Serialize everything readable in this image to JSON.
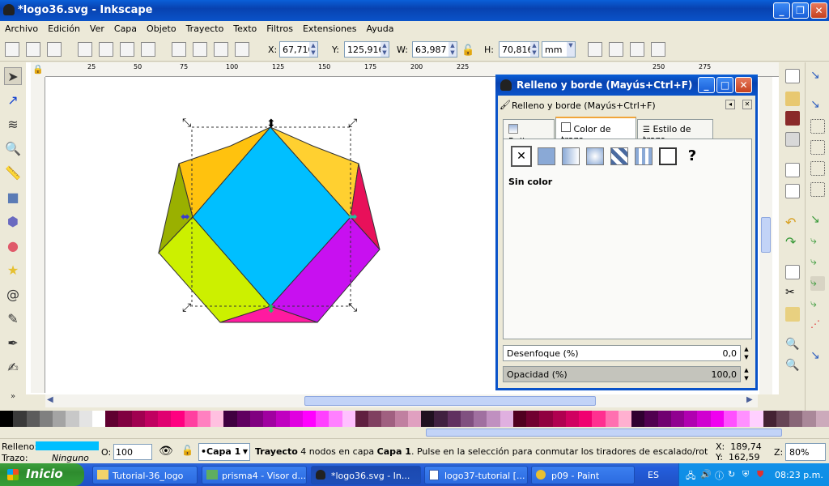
{
  "window": {
    "title": "*logo36.svg - Inkscape",
    "min_icon": "minimize-icon",
    "max_icon": "maximize-icon",
    "close_icon": "close-icon"
  },
  "menu": [
    "Archivo",
    "Edición",
    "Ver",
    "Capa",
    "Objeto",
    "Trayecto",
    "Texto",
    "Filtros",
    "Extensiones",
    "Ayuda"
  ],
  "toolbar": {
    "x_label": "X:",
    "x_value": "67,710",
    "y_label": "Y:",
    "y_value": "125,916",
    "w_label": "W:",
    "w_value": "63,987",
    "h_label": "H:",
    "h_value": "70,816",
    "unit": "mm"
  },
  "ruler": {
    "ticks": [
      "25",
      "50",
      "75",
      "100",
      "125",
      "150",
      "175",
      "200",
      "225",
      "250",
      "275"
    ]
  },
  "dialog": {
    "title": "Relleno y borde (Mayús+Ctrl+F)",
    "subtitle": "Relleno y borde (Mayús+Ctrl+F)",
    "tabs": [
      "Relleno",
      "Color de trazo",
      "Estilo de trazo"
    ],
    "active_tab": "Color de trazo",
    "paint_state": "Sin color",
    "blur_label": "Desenfoque (%)",
    "blur_value": "0,0",
    "opacity_label": "Opacidad (%)",
    "opacity_value": "100,0"
  },
  "status": {
    "fill_label": "Relleno:",
    "fill_color": "#00bfff",
    "stroke_label": "Trazo:",
    "stroke_value": "Ninguno",
    "o_label": "O:",
    "o_value": "100",
    "layer": "•Capa 1",
    "message_bold": "Trayecto",
    "message": " 4 nodos en capa ",
    "message_layer": "Capa 1",
    "message_rest": ". Pulse en la selección para conmutar los tiradores de escalado/rotación.",
    "x_coord": "X:  189,74",
    "y_coord": "Y:  162,59",
    "zoom_label": "Z:",
    "zoom": "80%"
  },
  "taskbar": {
    "start": "Inicio",
    "tasks": [
      "Tutorial-36_logo",
      "prisma4 - Visor d...",
      "*logo36.svg - In...",
      "logo37-tutorial [...",
      "p09 - Paint"
    ],
    "lang": "ES",
    "clock": "08:23 p.m."
  },
  "palette": [
    "#000000",
    "#3a3a3a",
    "#5c5c5c",
    "#808080",
    "#a4a4a4",
    "#c8c8c8",
    "#e4e4e4",
    "#ffffff",
    "#600030",
    "#800040",
    "#a00050",
    "#c00060",
    "#e00070",
    "#ff0080",
    "#ff40a0",
    "#ff80c0",
    "#ffc0e0",
    "#400040",
    "#600060",
    "#800080",
    "#a000a0",
    "#c000c0",
    "#e000e0",
    "#ff00ff",
    "#ff40ff",
    "#ff80ff",
    "#ffc0ff",
    "#602040",
    "#804060",
    "#a06080",
    "#c080a0",
    "#e0a0c0",
    "#201020",
    "#402040",
    "#603060",
    "#805080",
    "#a070a0",
    "#c090c0",
    "#e0b0e0",
    "#500020",
    "#700030",
    "#900040",
    "#b00050",
    "#d00060",
    "#f00070",
    "#ff3090",
    "#ff70b0",
    "#ffb0d0",
    "#300030",
    "#500050",
    "#700070",
    "#900090",
    "#b000b0",
    "#d000d0",
    "#f000f0",
    "#ff50ff",
    "#ff90ff",
    "#ffd0ff",
    "#442233",
    "#664455",
    "#886677",
    "#aa8899",
    "#ccaabb"
  ]
}
